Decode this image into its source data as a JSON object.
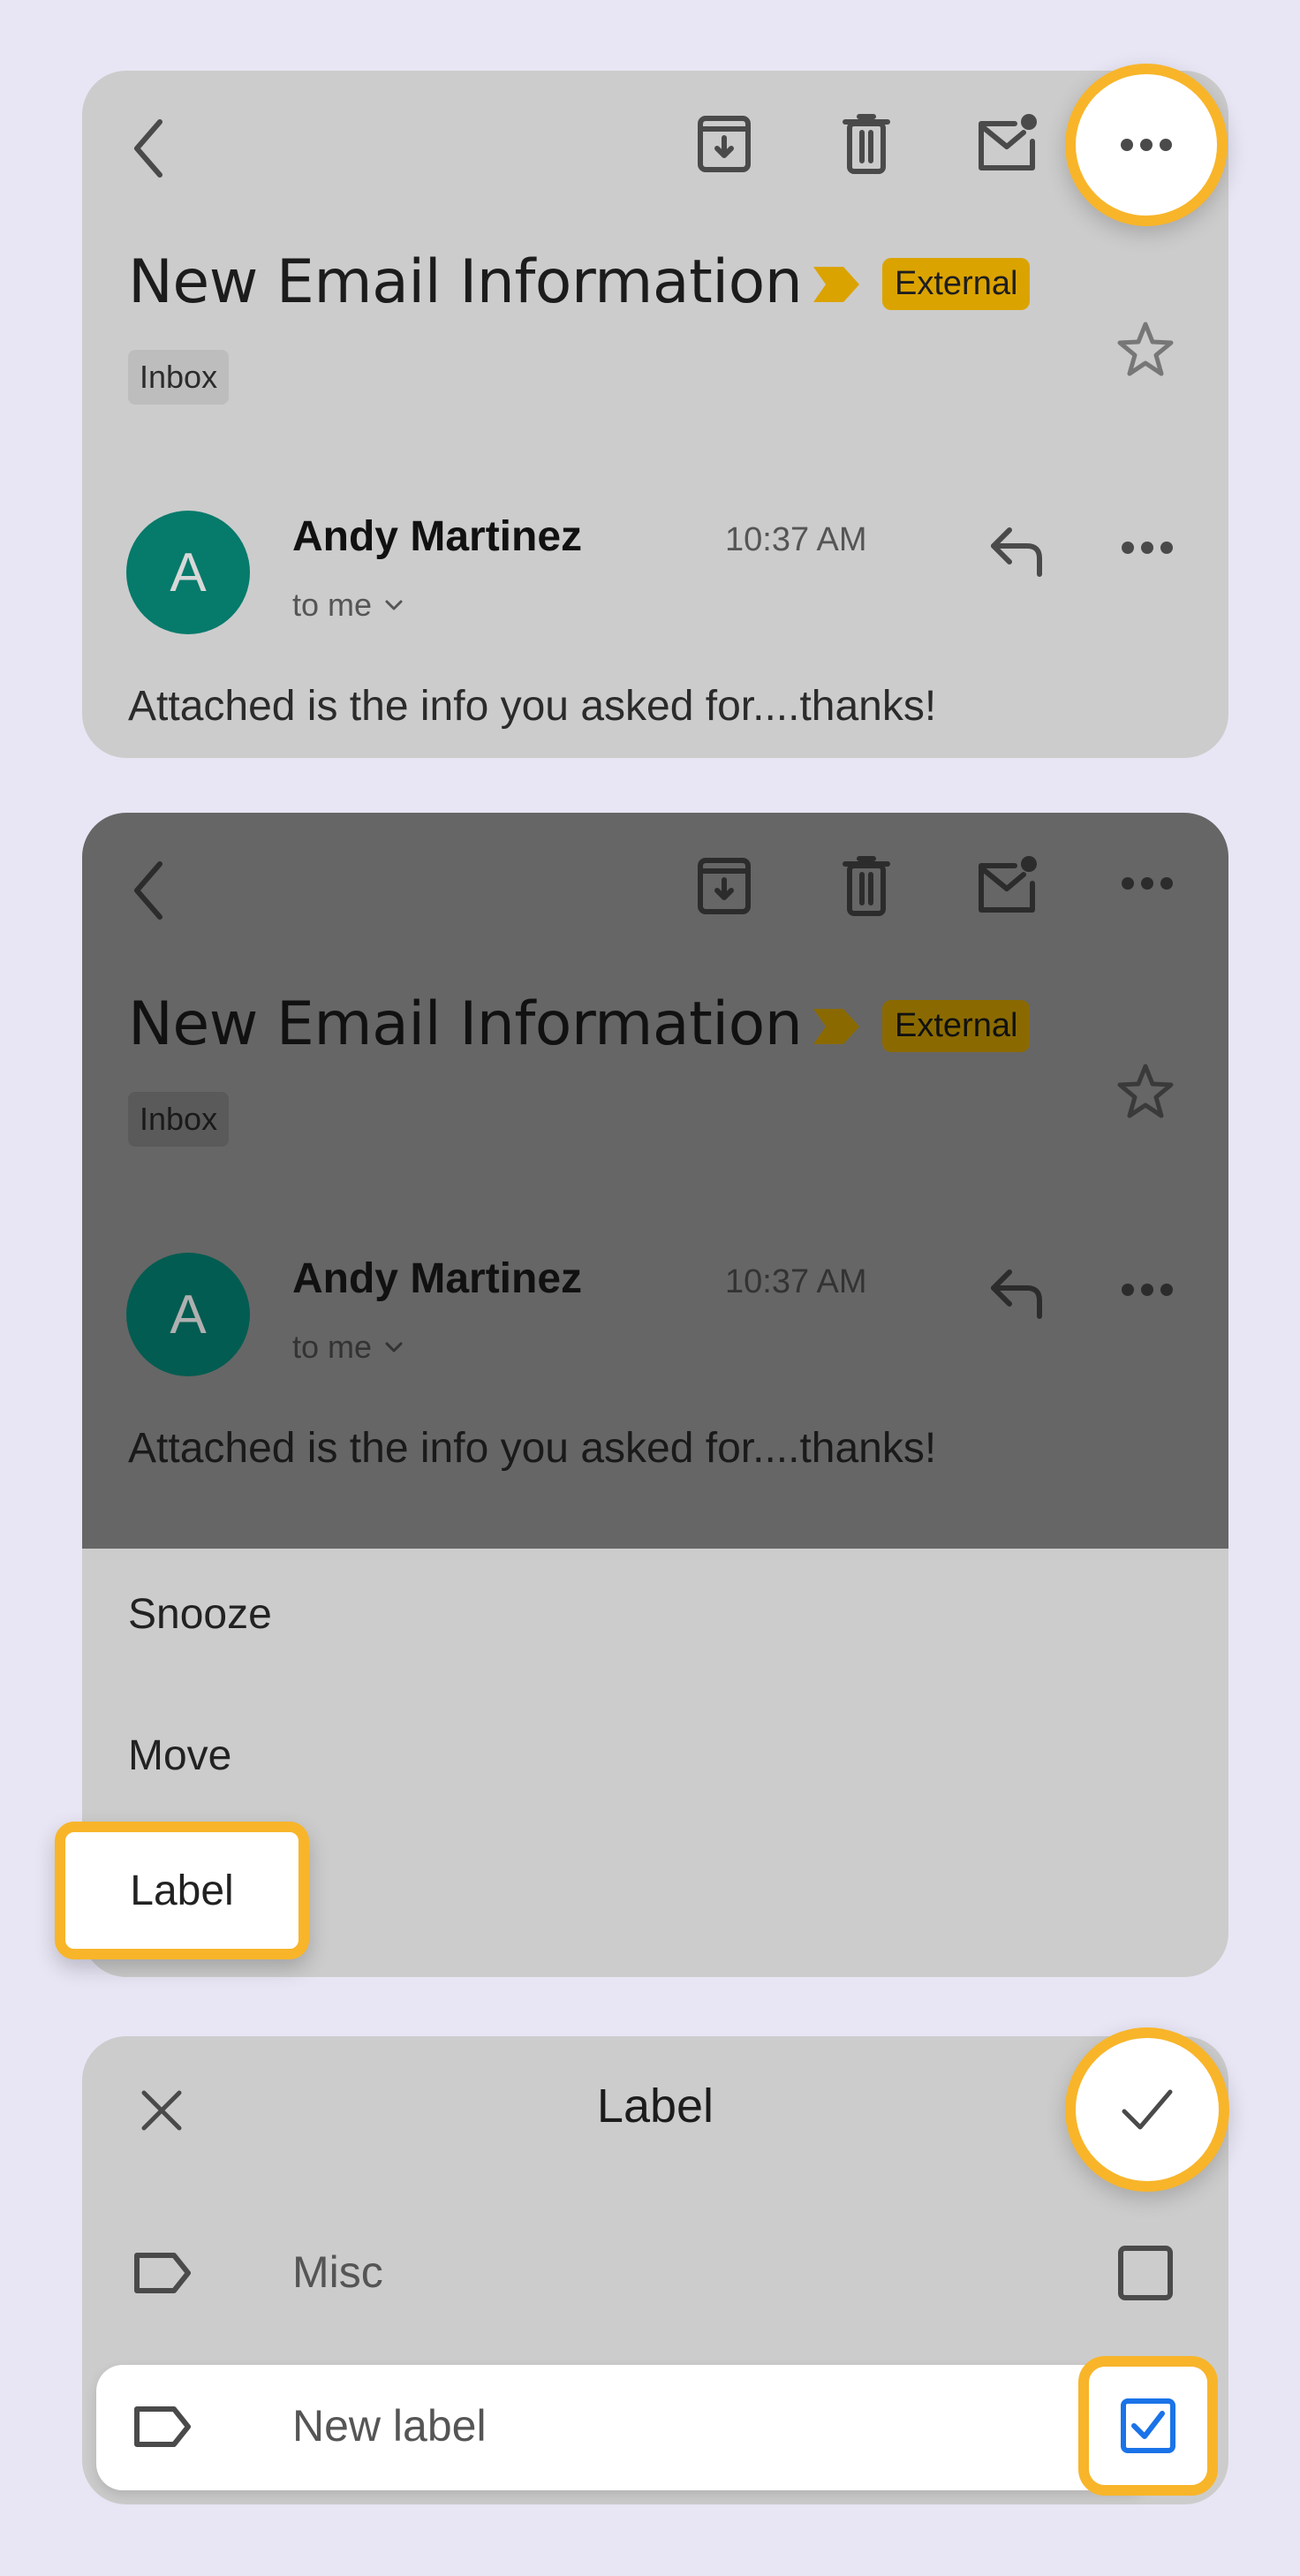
{
  "email": {
    "subject": "New Email Information",
    "external_badge": "External",
    "folder_chip": "Inbox",
    "sender_initial": "A",
    "sender_name": "Andy Martinez",
    "time": "10:37 AM",
    "recipient": "to me",
    "body": "Attached is the info you asked for....thanks!"
  },
  "toolbar": {
    "icons": [
      "back-icon",
      "archive-icon",
      "delete-icon",
      "mark-unread-icon",
      "more-options-icon"
    ]
  },
  "menu": {
    "items": [
      {
        "label": "Snooze"
      },
      {
        "label": "Move"
      },
      {
        "label": "Label"
      }
    ]
  },
  "label_sheet": {
    "title": "Label",
    "labels": [
      {
        "name": "Misc",
        "checked": false
      },
      {
        "name": "New label",
        "checked": true
      }
    ]
  },
  "colors": {
    "highlight": "#f8b52a",
    "avatar": "#067a6b",
    "external_badge": "#dba300",
    "checkbox_checked": "#1a73e8"
  }
}
